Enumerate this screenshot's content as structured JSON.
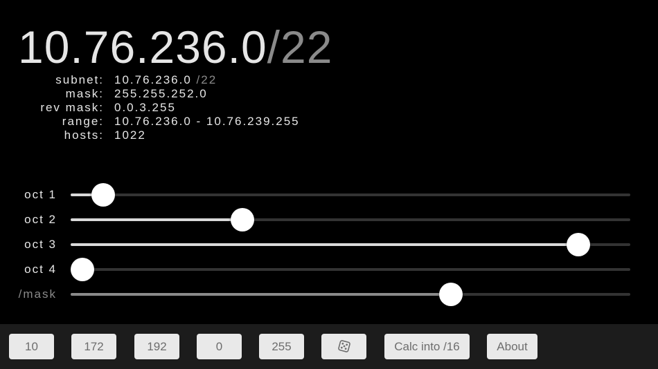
{
  "header": {
    "ip": "10.76.236.0",
    "cidr": "/22"
  },
  "info": {
    "subnet_label": "subnet:",
    "subnet_value": "10.76.236.0",
    "subnet_cidr": "/22",
    "mask_label": "mask:",
    "mask_value": "255.255.252.0",
    "revmask_label": "rev mask:",
    "revmask_value": "0.0.3.255",
    "range_label": "range:",
    "range_value": "10.76.236.0 - 10.76.239.255",
    "hosts_label": "hosts:",
    "hosts_value": "1022"
  },
  "sliders": [
    {
      "label": "oct 1",
      "value": 10,
      "max": 255
    },
    {
      "label": "oct 2",
      "value": 76,
      "max": 255
    },
    {
      "label": "oct 3",
      "value": 236,
      "max": 255
    },
    {
      "label": "oct 4",
      "value": 0,
      "max": 255
    },
    {
      "label": "/mask",
      "value": 22,
      "max": 32
    }
  ],
  "toolbar": {
    "btn_10": "10",
    "btn_172": "172",
    "btn_192": "192",
    "btn_0": "0",
    "btn_255": "255",
    "random_icon": "dice-icon",
    "calc": "Calc into /16",
    "about": "About"
  },
  "colors": {
    "background": "#000000",
    "text": "#e6e6e6",
    "dim_text": "#8a8a8a",
    "toolbar_bg": "#1c1c1c",
    "button_bg": "#e9e9e9",
    "button_text": "#6d6d6d"
  }
}
